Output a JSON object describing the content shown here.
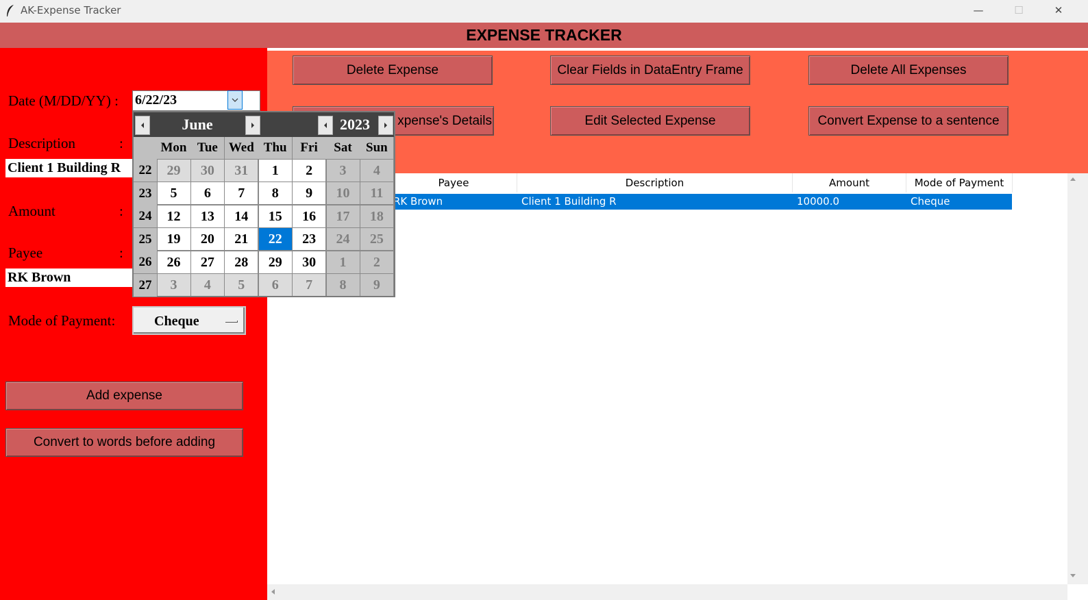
{
  "window": {
    "title": "AK-Expense Tracker",
    "minimize": "—",
    "maximize": "☐",
    "close": "✕"
  },
  "header": {
    "title": "EXPENSE TRACKER"
  },
  "form": {
    "date_label": "Date (M/DD/YY) :",
    "date_value": "6/22/23",
    "description_label": "Description",
    "description_colon": ":",
    "description_value": "Client 1 Building R",
    "amount_label": "Amount",
    "amount_colon": ":",
    "payee_label": "Payee",
    "payee_colon": ":",
    "payee_value": "RK Brown",
    "mode_label": "Mode of Payment:",
    "mode_value": "Cheque",
    "add_button": "Add expense",
    "convert_button": "Convert to words before adding"
  },
  "toolbar": {
    "delete_expense": "Delete Expense",
    "clear_fields": "Clear Fields in DataEntry Frame",
    "delete_all": "Delete All Expenses",
    "view_details": "xpense's Details",
    "edit_selected": "Edit Selected Expense",
    "convert_sentence": "Convert Expense to a sentence"
  },
  "table": {
    "columns": [
      "Payee",
      "Description",
      "Amount",
      "Mode of Payment"
    ],
    "rows": [
      {
        "payee": "RK Brown",
        "description": "Client 1 Building R",
        "amount": "10000.0",
        "mode": "Cheque"
      }
    ]
  },
  "calendar": {
    "month": "June",
    "year": "2023",
    "weekdays": [
      "Mon",
      "Tue",
      "Wed",
      "Thu",
      "Fri",
      "Sat",
      "Sun"
    ],
    "weeks": [
      {
        "num": "22",
        "days": [
          "29",
          "30",
          "31",
          "1",
          "2",
          "3",
          "4"
        ]
      },
      {
        "num": "23",
        "days": [
          "5",
          "6",
          "7",
          "8",
          "9",
          "10",
          "11"
        ]
      },
      {
        "num": "24",
        "days": [
          "12",
          "13",
          "14",
          "15",
          "16",
          "17",
          "18"
        ]
      },
      {
        "num": "25",
        "days": [
          "19",
          "20",
          "21",
          "22",
          "23",
          "24",
          "25"
        ]
      },
      {
        "num": "26",
        "days": [
          "26",
          "27",
          "28",
          "29",
          "30",
          "1",
          "2"
        ]
      },
      {
        "num": "27",
        "days": [
          "3",
          "4",
          "5",
          "6",
          "7",
          "8",
          "9"
        ]
      }
    ],
    "selected_day": "22"
  },
  "colors": {
    "header": "#cd5c5c",
    "left_panel": "#ff0000",
    "toolbar_area": "#ff6347",
    "button": "#cd5c5c",
    "selection": "#0078d7",
    "calendar_header": "#424242"
  },
  "icons": {
    "app": "feather-icon",
    "dropdown": "chevron-down-icon",
    "menu": "option-menu-indicator"
  }
}
